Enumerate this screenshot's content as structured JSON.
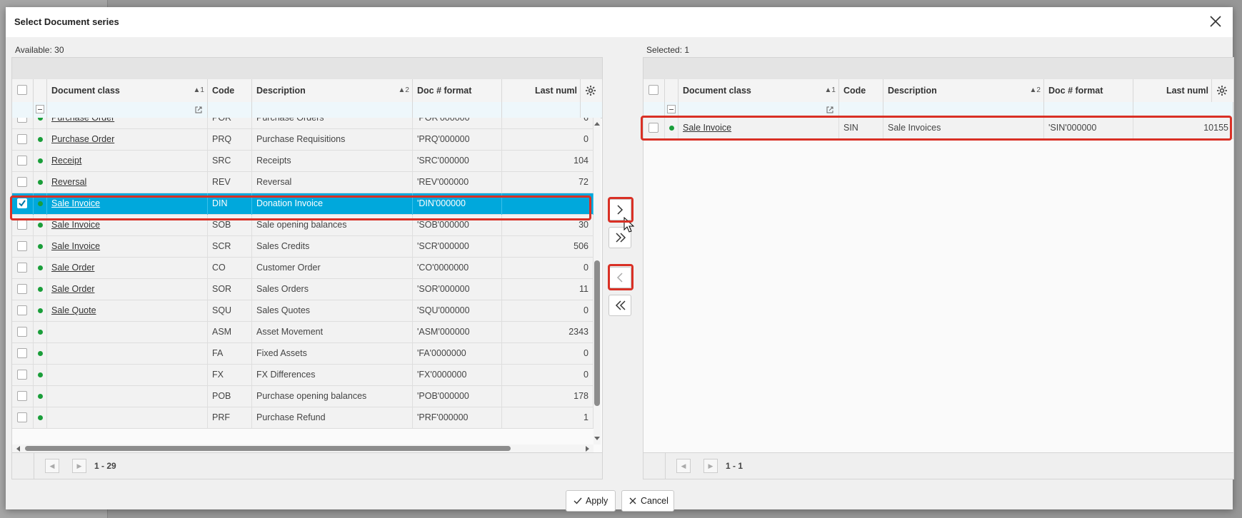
{
  "dialog": {
    "title": "Select Document series",
    "close_label": "Close"
  },
  "available": {
    "count_label": "Available: 30",
    "columns": [
      {
        "label": "Document class",
        "sort": "▲1"
      },
      {
        "label": "Code",
        "sort": ""
      },
      {
        "label": "Description",
        "sort": "▲2"
      },
      {
        "label": "Doc # format",
        "sort": ""
      },
      {
        "label": "Last numl",
        "sort": ""
      }
    ],
    "rows": [
      {
        "doc_class": "Purchase Order",
        "code": "POR",
        "description": "Purchase Orders",
        "format": "'POR'000000",
        "last": "6",
        "checked": false,
        "active": true
      },
      {
        "doc_class": "Purchase Order",
        "code": "PRQ",
        "description": "Purchase Requisitions",
        "format": "'PRQ'000000",
        "last": "0",
        "checked": false,
        "active": true
      },
      {
        "doc_class": "Receipt",
        "code": "SRC",
        "description": "Receipts",
        "format": "'SRC'000000",
        "last": "104",
        "checked": false,
        "active": true
      },
      {
        "doc_class": "Reversal",
        "code": "REV",
        "description": "Reversal",
        "format": "'REV'000000",
        "last": "72",
        "checked": false,
        "active": true
      },
      {
        "doc_class": "Sale Invoice",
        "code": "DIN",
        "description": "Donation Invoice",
        "format": "'DIN'000000",
        "last": "",
        "checked": true,
        "active": true,
        "selected": true
      },
      {
        "doc_class": "Sale Invoice",
        "code": "SOB",
        "description": "Sale opening balances",
        "format": "'SOB'000000",
        "last": "30",
        "checked": false,
        "active": true
      },
      {
        "doc_class": "Sale Invoice",
        "code": "SCR",
        "description": "Sales Credits",
        "format": "'SCR'000000",
        "last": "506",
        "checked": false,
        "active": true
      },
      {
        "doc_class": "Sale Order",
        "code": "CO",
        "description": "Customer Order",
        "format": "'CO'0000000",
        "last": "0",
        "checked": false,
        "active": true
      },
      {
        "doc_class": "Sale Order",
        "code": "SOR",
        "description": "Sales Orders",
        "format": "'SOR'000000",
        "last": "11",
        "checked": false,
        "active": true
      },
      {
        "doc_class": "Sale Quote",
        "code": "SQU",
        "description": "Sales Quotes",
        "format": "'SQU'000000",
        "last": "0",
        "checked": false,
        "active": true
      },
      {
        "doc_class": "",
        "code": "ASM",
        "description": "Asset Movement",
        "format": "'ASM'000000",
        "last": "2343",
        "checked": false,
        "active": true
      },
      {
        "doc_class": "",
        "code": "FA",
        "description": "Fixed Assets",
        "format": "'FA'0000000",
        "last": "0",
        "checked": false,
        "active": true
      },
      {
        "doc_class": "",
        "code": "FX",
        "description": "FX Differences",
        "format": "'FX'0000000",
        "last": "0",
        "checked": false,
        "active": true
      },
      {
        "doc_class": "",
        "code": "POB",
        "description": "Purchase opening balances",
        "format": "'POB'000000",
        "last": "178",
        "checked": false,
        "active": true
      },
      {
        "doc_class": "",
        "code": "PRF",
        "description": "Purchase Refund",
        "format": "'PRF'000000",
        "last": "1",
        "checked": false,
        "active": true
      }
    ],
    "pager_text": "1 - 29"
  },
  "selected": {
    "count_label": "Selected: 1",
    "columns": [
      {
        "label": "Document class",
        "sort": "▲1"
      },
      {
        "label": "Code",
        "sort": ""
      },
      {
        "label": "Description",
        "sort": "▲2"
      },
      {
        "label": "Doc # format",
        "sort": ""
      },
      {
        "label": "Last numl",
        "sort": ""
      }
    ],
    "rows": [
      {
        "doc_class": "Sale Invoice",
        "code": "SIN",
        "description": "Sale Invoices",
        "format": "'SIN'000000",
        "last": "10155",
        "checked": false,
        "active": true
      }
    ],
    "pager_text": "1 - 1"
  },
  "buttons": {
    "apply": "Apply",
    "cancel": "Cancel"
  },
  "colors": {
    "selected_row": "#00a8dc",
    "active_dot": "#1a9e3a",
    "highlight": "#d93025"
  },
  "icons": {
    "settings": "gear-icon",
    "move_right": "chevron-right-icon",
    "move_all_right": "double-chevron-right-icon",
    "move_left": "chevron-left-icon",
    "move_all_left": "double-chevron-left-icon",
    "close": "close-icon",
    "apply": "check-icon",
    "cancel": "x-icon"
  }
}
